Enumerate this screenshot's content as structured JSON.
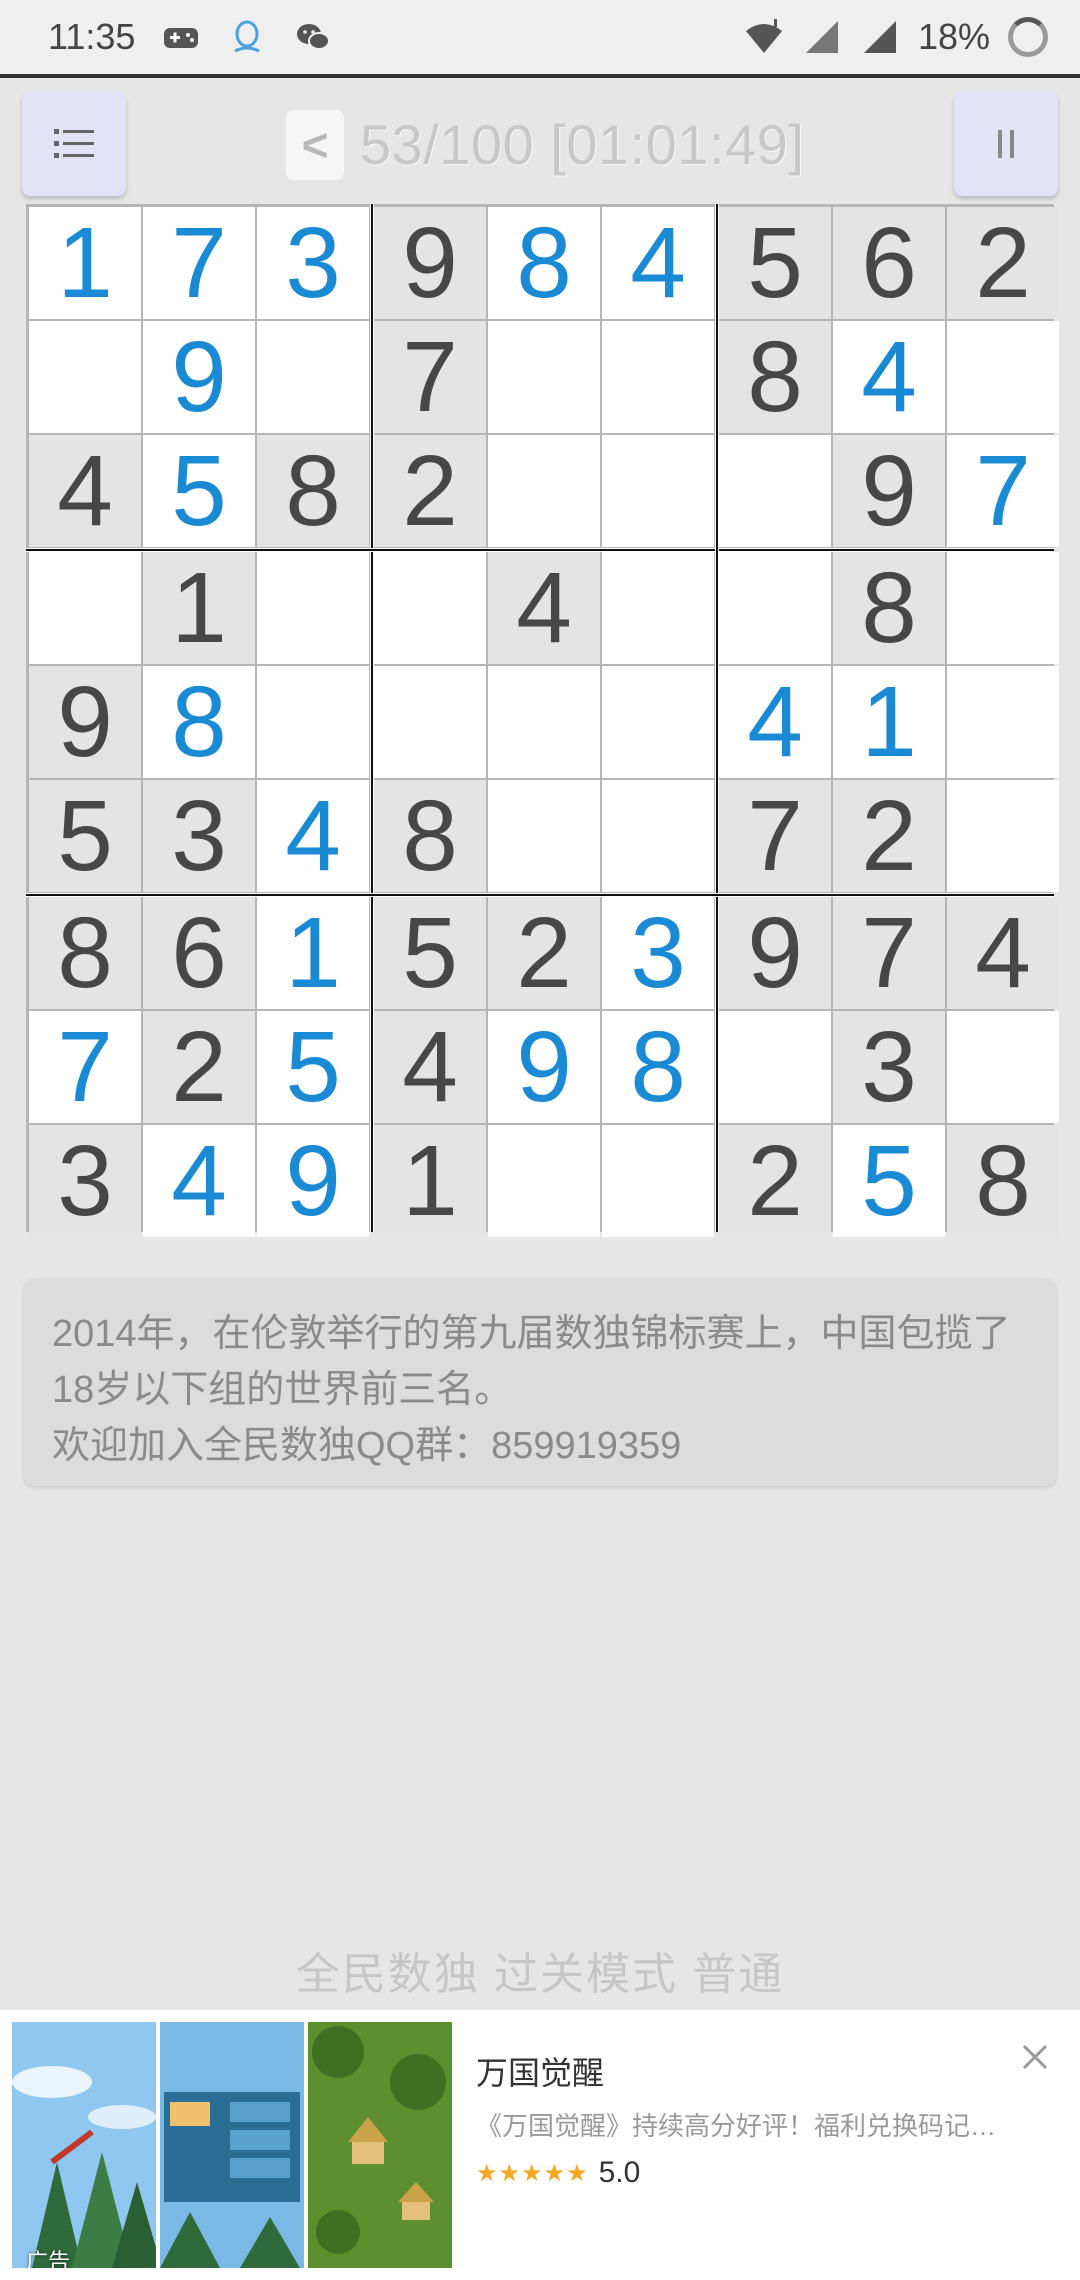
{
  "status_bar": {
    "time": "11:35",
    "left_icons": [
      "gamepad-icon",
      "qq-icon",
      "wechat-icon"
    ],
    "battery": "18%",
    "right_icons": [
      "wifi-icon",
      "signal-icon",
      "signal-icon",
      "battery-icon"
    ]
  },
  "toolbar": {
    "menu_icon": "menu-icon",
    "back_label": "<",
    "level_timer": "53/100 [01:01:49]",
    "pause_icon": "pause-icon"
  },
  "grid": {
    "rows": [
      [
        "1",
        "7",
        "3",
        "9",
        "8",
        "4",
        "5",
        "6",
        "2"
      ],
      [
        "",
        "9",
        "",
        "7",
        "",
        "",
        "8",
        "4",
        ""
      ],
      [
        "4",
        "5",
        "8",
        "2",
        "",
        "",
        "",
        "9",
        "7"
      ],
      [
        "",
        "1",
        "",
        "",
        "4",
        "",
        "",
        "8",
        ""
      ],
      [
        "9",
        "8",
        "",
        "",
        "",
        "",
        "4",
        "1",
        ""
      ],
      [
        "5",
        "3",
        "4",
        "8",
        "",
        "",
        "7",
        "2",
        ""
      ],
      [
        "8",
        "6",
        "1",
        "5",
        "2",
        "3",
        "9",
        "7",
        "4"
      ],
      [
        "7",
        "2",
        "5",
        "4",
        "9",
        "8",
        "",
        "3",
        ""
      ],
      [
        "3",
        "4",
        "9",
        "1",
        "",
        "",
        "2",
        "5",
        "8"
      ]
    ],
    "types": [
      [
        "u",
        "u",
        "u",
        "g",
        "u",
        "u",
        "g",
        "g",
        "g"
      ],
      [
        "e",
        "u",
        "e",
        "g",
        "e",
        "e",
        "g",
        "u",
        "e"
      ],
      [
        "g",
        "u",
        "g",
        "g",
        "e",
        "e",
        "e",
        "g",
        "u"
      ],
      [
        "e",
        "g",
        "e",
        "e",
        "g",
        "e",
        "e",
        "g",
        "e"
      ],
      [
        "g",
        "u",
        "e",
        "e",
        "e",
        "e",
        "u",
        "u",
        "e"
      ],
      [
        "g",
        "g",
        "u",
        "g",
        "e",
        "e",
        "g",
        "g",
        "e"
      ],
      [
        "g",
        "g",
        "u",
        "g",
        "g",
        "u",
        "g",
        "g",
        "g"
      ],
      [
        "u",
        "g",
        "u",
        "g",
        "u",
        "u",
        "e",
        "g",
        "e"
      ],
      [
        "g",
        "u",
        "u",
        "g",
        "e",
        "e",
        "g",
        "u",
        "g"
      ]
    ],
    "colors": {
      "given_text": "#474747",
      "given_bg": "#e4e4e4",
      "user_text": "#1a8ad4",
      "empty_bg": "#ffffff"
    }
  },
  "tip": {
    "line1": "2014年，在伦敦举行的第九届数独锦标赛上，中国包揽了18岁以下组的世界前三名。",
    "line2": "欢迎加入全民数独QQ群：859919359"
  },
  "footer": {
    "mode": "全民数独 过关模式 普通"
  },
  "ad": {
    "tag": "广告",
    "title": "万国觉醒",
    "description": "《万国觉醒》持续高分好评！福利兑换码记…",
    "stars": "★★★★★",
    "score": "5.0",
    "close_icon": "close-icon"
  }
}
